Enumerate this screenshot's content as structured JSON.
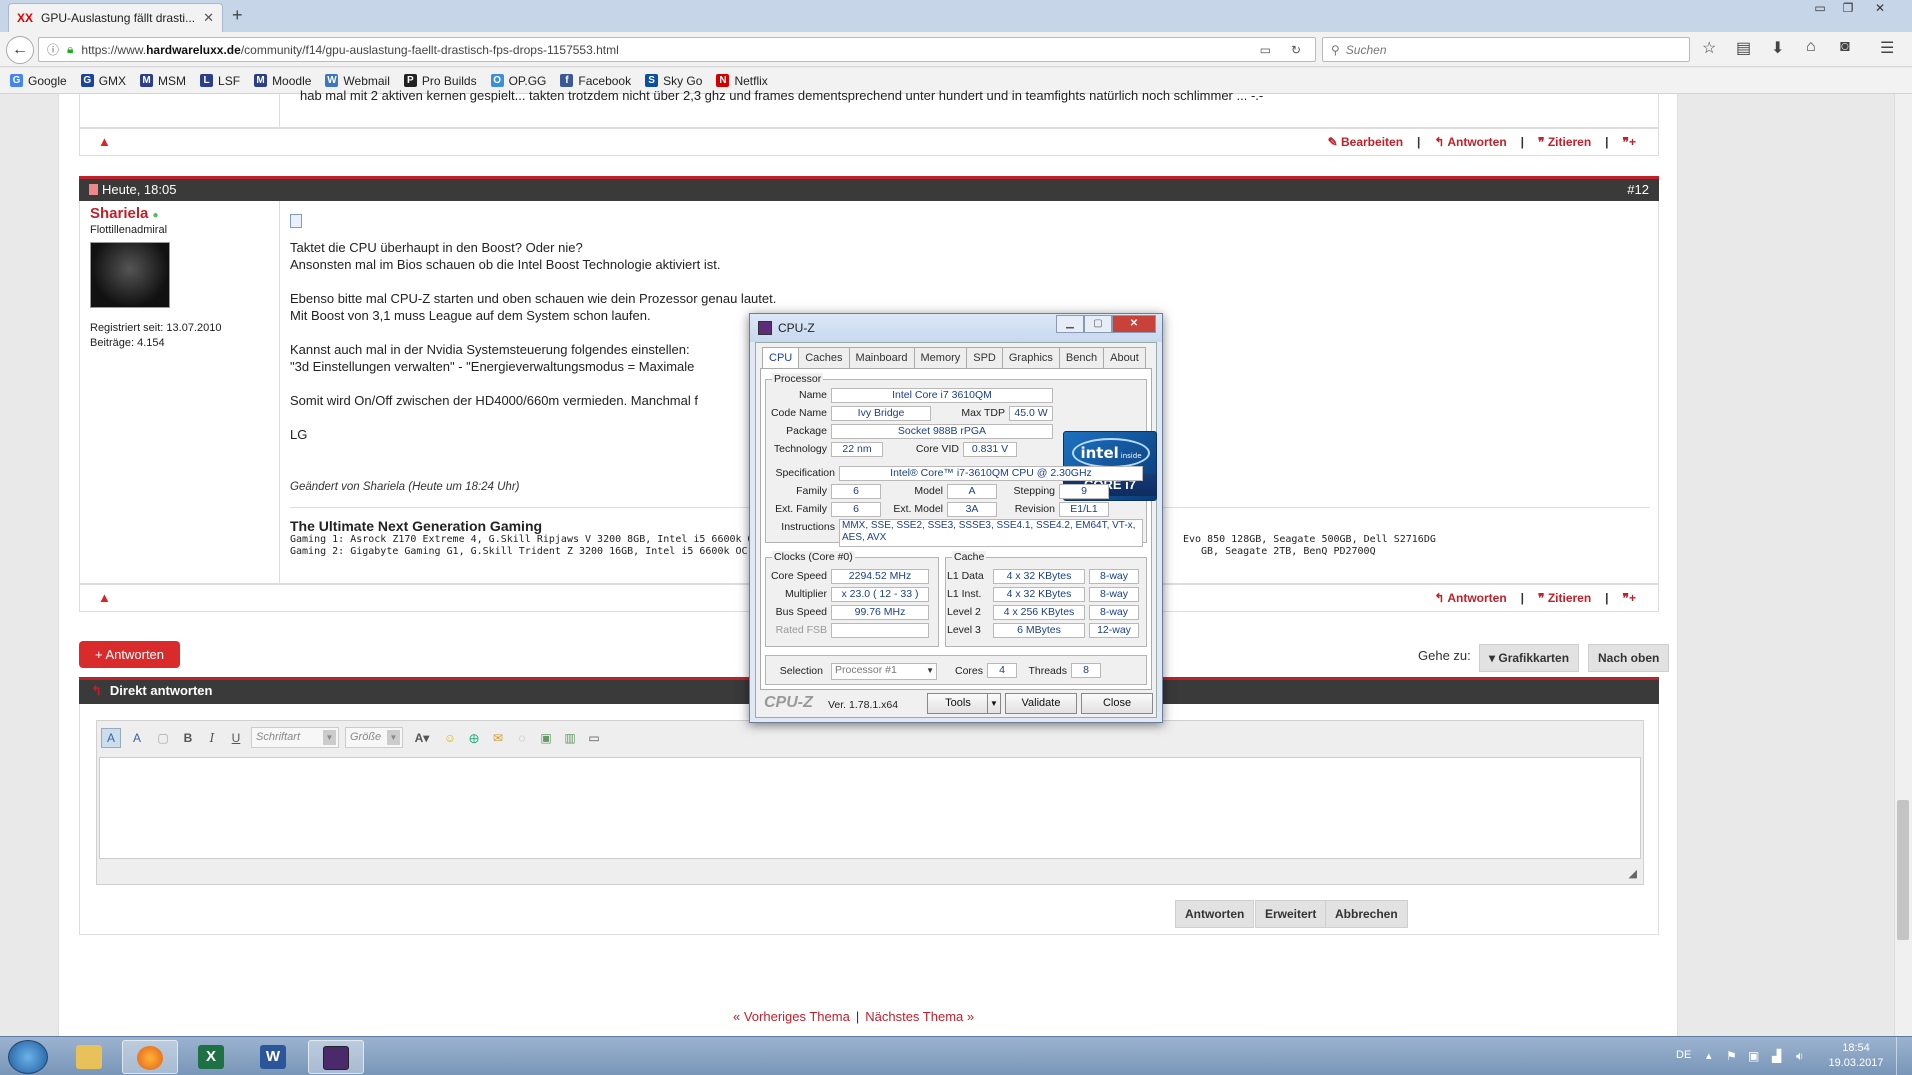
{
  "browser": {
    "tab_title": "GPU-Auslastung fällt drasti...",
    "tab_fav": "XX",
    "url_prefix": "https://www.",
    "url_domain": "hardwareluxx.de",
    "url_path": "/community/f14/gpu-auslastung-faellt-drastisch-fps-drops-1157553.html",
    "search_placeholder": "Suchen",
    "bookmarks": [
      {
        "label": "Google",
        "icon": "G",
        "color": "#4285f4"
      },
      {
        "label": "GMX",
        "icon": "G",
        "color": "#1c449b"
      },
      {
        "label": "MSM",
        "icon": "M",
        "color": "#2a3e8c"
      },
      {
        "label": "LSF",
        "icon": "L",
        "color": "#2a3e8c"
      },
      {
        "label": "Moodle",
        "icon": "M",
        "color": "#2a3e8c"
      },
      {
        "label": "Webmail",
        "icon": "W",
        "color": "#3a76c4"
      },
      {
        "label": "Pro Builds",
        "icon": "P",
        "color": "#222"
      },
      {
        "label": "OP.GG",
        "icon": "O",
        "color": "#3a8fd9"
      },
      {
        "label": "Facebook",
        "icon": "f",
        "color": "#3b5998"
      },
      {
        "label": "Sky Go",
        "icon": "S",
        "color": "#0a4fa0"
      },
      {
        "label": "Netflix",
        "icon": "N",
        "color": "#d40000"
      }
    ]
  },
  "prev_post": {
    "text_tail": "hab mal mit 2 aktiven kernen gespielt... takten trotzdem nicht über 2,3 ghz und frames dementsprechend unter hundert und in teamfights natürlich noch schlimmer ... -.-",
    "actions": {
      "edit": "Bearbeiten",
      "reply": "Antworten",
      "quote": "Zitieren"
    }
  },
  "post": {
    "date": "Heute, 18:05",
    "number": "#12",
    "author": "Shariela",
    "rank": "Flottillenadmiral",
    "registered": "Registriert seit: 13.07.2010",
    "posts": "Beiträge: 4.154",
    "lines": [
      "Taktet die CPU überhaupt in den Boost? Oder nie?",
      "Ansonsten mal im Bios schauen ob die Intel Boost Technologie aktiviert ist.",
      "Ebenso bitte mal CPU-Z starten und oben schauen wie dein Prozessor genau lautet.",
      "Mit Boost von 3,1 muss League auf dem System schon laufen.",
      "Kannst auch mal in der Nvidia Systemsteuerung folgendes einstellen:",
      "\"3d Einstellungen verwalten\" - \"Energieverwaltungsmodus = Maximale",
      "Somit wird On/Off zwischen der HD4000/660m vermieden. Manchmal f",
      "LG"
    ],
    "edited": "Geändert von Shariela (Heute um 18:24 Uhr)",
    "sig_title": "The Ultimate Next Generation Gaming",
    "sig_line1": "Gaming 1: Asrock Z170 Extreme 4, G.Skill Ripjaws V 3200 8GB, Intel i5 6600k OC,",
    "sig_line1_end": "Evo 850 128GB, Seagate 500GB, Dell S2716DG",
    "sig_line2": "Gaming 2: Gigabyte Gaming G1, G.Skill Trident Z 3200 16GB, Intel i5 6600k OC,",
    "sig_line2_end": "GB, Seagate 2TB, BenQ PD2700Q",
    "actions": {
      "reply": "Antworten",
      "quote": "Zitieren"
    }
  },
  "reply_button": "+ Antworten",
  "goto": {
    "label": "Gehe zu:",
    "forum": "Grafikkarten",
    "top": "Nach oben"
  },
  "quick_reply": {
    "title": "Direkt antworten",
    "font_select": "Schriftart",
    "size_select": "Größe",
    "buttons": {
      "submit": "Antworten",
      "advanced": "Erweitert",
      "cancel": "Abbrechen"
    }
  },
  "thread_nav": {
    "prev": "« Vorheriges Thema",
    "sep": "|",
    "next": "Nächstes Thema »"
  },
  "cpuz": {
    "title": "CPU-Z",
    "tabs": [
      "CPU",
      "Caches",
      "Mainboard",
      "Memory",
      "SPD",
      "Graphics",
      "Bench",
      "About"
    ],
    "processor_label": "Processor",
    "name_label": "Name",
    "name": "Intel Core i7 3610QM",
    "codename_label": "Code Name",
    "codename": "Ivy Bridge",
    "maxtdp_label": "Max TDP",
    "maxtdp": "45.0 W",
    "package_label": "Package",
    "package": "Socket 988B rPGA",
    "technology_label": "Technology",
    "technology": "22 nm",
    "corevid_label": "Core VID",
    "corevid": "0.831 V",
    "spec_label": "Specification",
    "spec": "Intel® Core™ i7-3610QM CPU @ 2.30GHz",
    "family_label": "Family",
    "family": "6",
    "model_label": "Model",
    "model": "A",
    "stepping_label": "Stepping",
    "stepping": "9",
    "extfamily_label": "Ext. Family",
    "extfamily": "6",
    "extmodel_label": "Ext. Model",
    "extmodel": "3A",
    "revision_label": "Revision",
    "revision": "E1/L1",
    "instr_label": "Instructions",
    "instr": "MMX, SSE, SSE2, SSE3, SSSE3, SSE4.1, SSE4.2, EM64T, VT-x, AES, AVX",
    "clocks_label": "Clocks (Core #0)",
    "corespeed_label": "Core Speed",
    "corespeed": "2294.52 MHz",
    "multiplier_label": "Multiplier",
    "multiplier": "x 23.0 ( 12 - 33 )",
    "busspeed_label": "Bus Speed",
    "busspeed": "99.76 MHz",
    "ratedfsb_label": "Rated FSB",
    "ratedfsb": "",
    "cache_label": "Cache",
    "l1d_label": "L1 Data",
    "l1d": "4 x 32 KBytes",
    "l1d_way": "8-way",
    "l1i_label": "L1 Inst.",
    "l1i": "4 x 32 KBytes",
    "l1i_way": "8-way",
    "l2_label": "Level 2",
    "l2": "4 x 256 KBytes",
    "l2_way": "8-way",
    "l3_label": "Level 3",
    "l3": "6 MBytes",
    "l3_way": "12-way",
    "selection_label": "Selection",
    "selection": "Processor #1",
    "cores_label": "Cores",
    "cores": "4",
    "threads_label": "Threads",
    "threads": "8",
    "brand": "CPU-Z",
    "version": "Ver. 1.78.1.x64",
    "tools": "Tools",
    "validate": "Validate",
    "close": "Close",
    "intel_logo": "intel",
    "intel_inside": "inside",
    "core_i7": "CORE i7"
  },
  "taskbar": {
    "lang": "DE",
    "time": "18:54",
    "date": "19.03.2017"
  }
}
